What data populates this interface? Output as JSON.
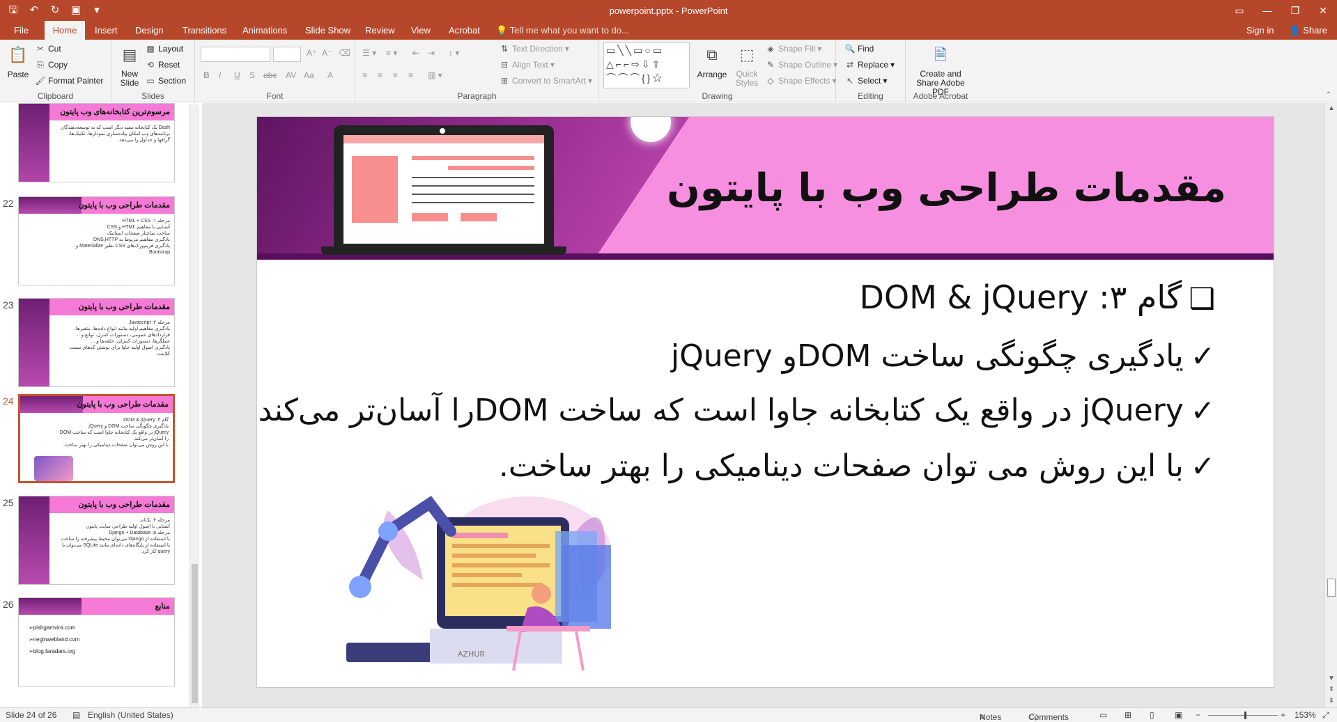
{
  "window": {
    "title": "powerpoint.pptx - PowerPoint",
    "controls": [
      "▭",
      "—",
      "❐",
      "✕"
    ]
  },
  "qat": [
    "save-icon",
    "undo-icon",
    "redo-icon",
    "slideshow-icon",
    "customize-icon"
  ],
  "tabs": [
    "File",
    "Home",
    "Insert",
    "Design",
    "Transitions",
    "Animations",
    "Slide Show",
    "Review",
    "View",
    "Acrobat"
  ],
  "active_tab": "Home",
  "tell_me": "Tell me what you want to do...",
  "account": {
    "signin": "Sign in",
    "share": "Share"
  },
  "ribbon": {
    "clipboard": {
      "label": "Clipboard",
      "paste": "Paste",
      "cut": "Cut",
      "copy": "Copy",
      "format_painter": "Format Painter"
    },
    "slides": {
      "label": "Slides",
      "new_slide": "New Slide",
      "layout": "Layout",
      "reset": "Reset",
      "section": "Section"
    },
    "font": {
      "label": "Font",
      "bold": "B",
      "italic": "I",
      "underline": "U",
      "strike": "S",
      "shadow": "abc",
      "spacing": "AV",
      "case": "Aa",
      "color": "A"
    },
    "paragraph": {
      "label": "Paragraph",
      "text_direction": "Text Direction",
      "align_text": "Align Text",
      "smartart": "Convert to SmartArt"
    },
    "drawing": {
      "label": "Drawing",
      "arrange": "Arrange",
      "quick_styles": "Quick Styles",
      "shape_fill": "Shape Fill",
      "shape_outline": "Shape Outline",
      "shape_effects": "Shape Effects"
    },
    "editing": {
      "label": "Editing",
      "find": "Find",
      "replace": "Replace",
      "select": "Select"
    },
    "acrobat": {
      "label": "Adobe Acrobat",
      "create": "Create and Share Adobe PDF"
    }
  },
  "thumbnails": [
    {
      "num": "",
      "title": "مرسوم‌ترین کتابخانه‌های وب پایتون",
      "lines": [
        "Dash یک کتابخانه مفید دیگر است که به توسعه‌دهندگان",
        "برنامه‌های وب امکان پیاده‌سازی نمودارها، تکنیک‌ها،",
        "گرافها و جداول را می‌دهد."
      ]
    },
    {
      "num": "22",
      "title": "مقدمات طراحی وب با پایتون",
      "lines": [
        "مرحله ۱: HTML + CSS",
        "آشنایی با مفاهیم HTML و CSS",
        "ساخت ساختار صفحات استاتیک",
        "یادگیری مفاهیم مربوط به DNS,HTTP",
        "یادگیری فریم‌ورک‌های CSS نظیر Materialize و Bootstrap"
      ]
    },
    {
      "num": "23",
      "title": "مقدمات طراحی وب با پایتون",
      "lines": [
        "مرحله ۲: Javascript",
        "یادگیری مفاهیم اولیه مانند انواع داده‌ها، متغیرها،",
        "قراردادهای عمومی، دستورات کنترل، توابع و ...",
        "عملگرها، دستورات کنترلی، حلقه‌ها و ...",
        "یادگیری اصول اولیه جاوا برای نوشتن کدهای سمت کلاینت"
      ]
    },
    {
      "num": "24",
      "title": "مقدمات طراحی وب با پایتون",
      "lines": [
        "گام ۳: DOM & jQuery",
        "یادگیری چگونگی ساخت DOM و jQuery",
        "jQuery در واقع یک کتابخانه جاوا است که ساخت DOM را آسان‌تر می‌کند.",
        "با این روش می‌توان صفحات دینامیکی را بهتر ساخت."
      ]
    },
    {
      "num": "25",
      "title": "مقدمات طراحی وب با پایتون",
      "lines": [
        "مرحله ۴: بک‌اند",
        "آشنایی با اصول اولیه طراحی سایت پایتون",
        "مرحله ۵: Django + Database",
        "با استفاده از Django می‌توان محیط پیشرفته را ساخت",
        "با استفاده از پایگاه‌های داده‌ای مانند SQLite می‌توان با query کار کرد"
      ]
    },
    {
      "num": "26",
      "title": "منابع",
      "links": [
        "pishgamvira.com",
        "neginwebland.com",
        "blog.faradars.org"
      ]
    }
  ],
  "slide": {
    "title": "مقدمات طراحی وب با پایتون",
    "bullets": [
      {
        "mark": "❑",
        "text": "گام ۳: DOM & jQuery"
      },
      {
        "mark": "✓",
        "text": "یادگیری چگونگی ساخت  DOMو  jQuery"
      },
      {
        "mark": "✓",
        "text": "jQuery در واقع یک کتابخانه جاوا است که ساخت DOMرا آسان‌تر می‌کند."
      },
      {
        "mark": "✓",
        "text": "با این روش می توان صفحات دینامیکی را بهتر ساخت."
      }
    ],
    "watermark": "AZHUR"
  },
  "status": {
    "slide": "Slide 24 of 26",
    "language": "English (United States)",
    "notes": "Notes",
    "comments": "Comments",
    "zoom": "153%"
  },
  "colors": {
    "accent": "#b7472a",
    "banner_pink": "#f78fe0",
    "banner_purple": "#5a0f5e"
  }
}
